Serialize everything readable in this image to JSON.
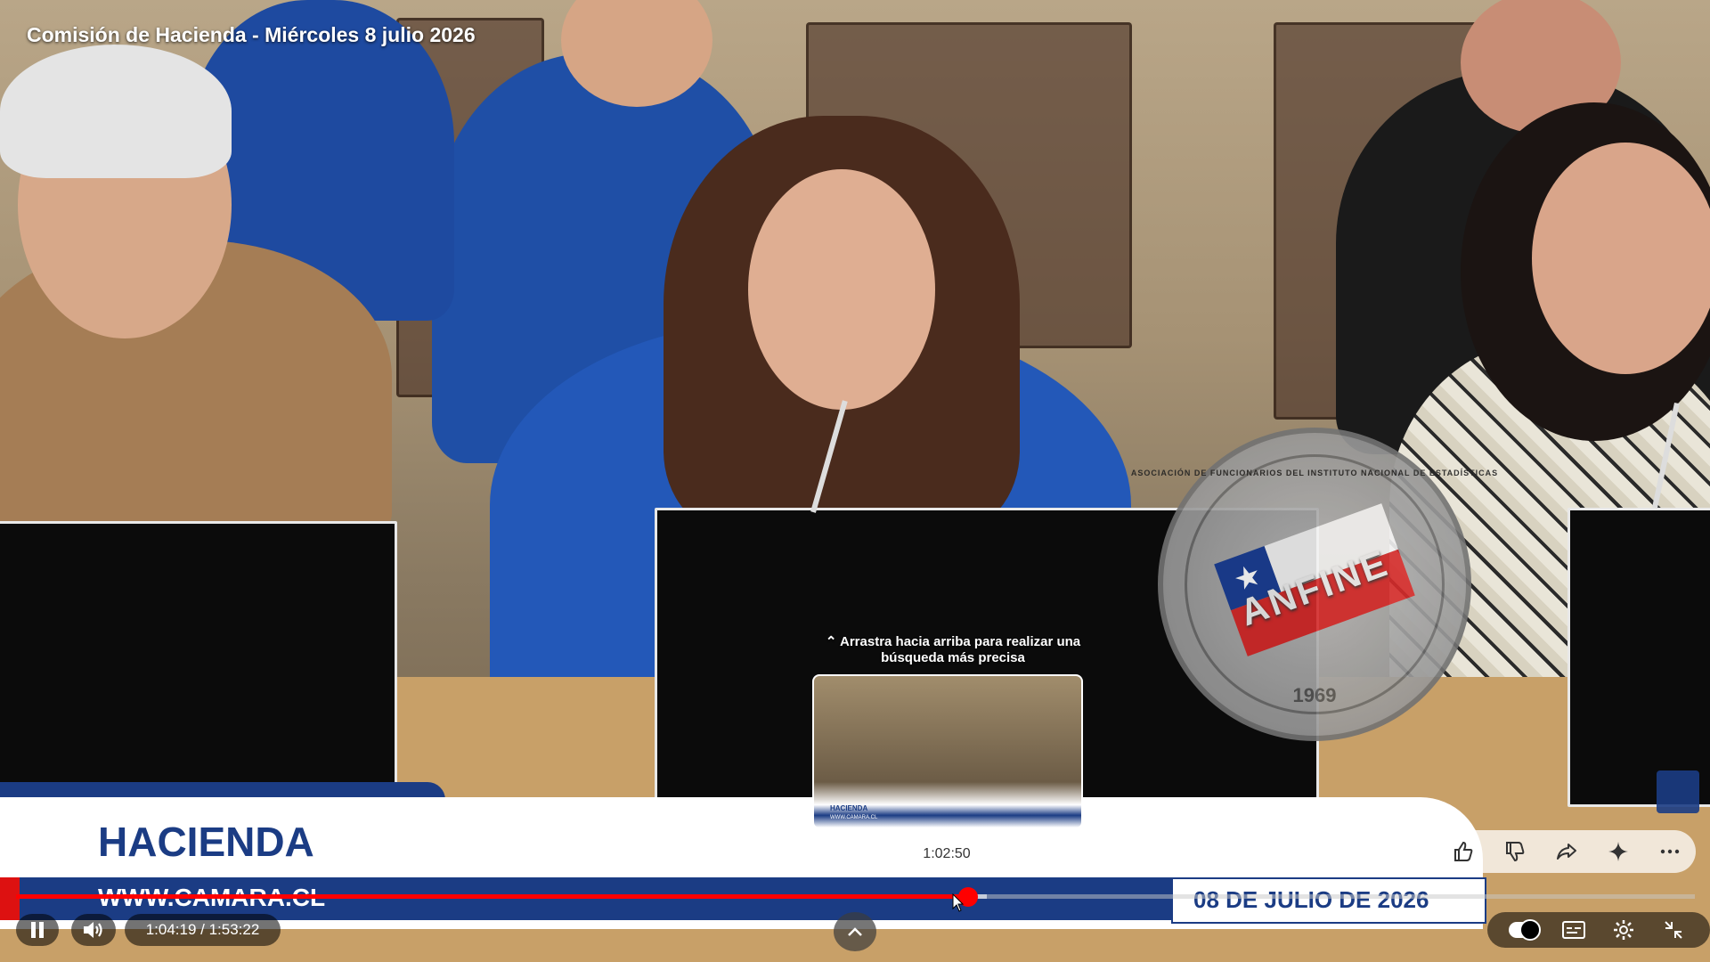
{
  "video": {
    "title_overlay": "Comisión de Hacienda - Miércoles 8 julio 2026"
  },
  "watermark": {
    "org_text": "ASOCIACIÓN DE FUNCIONARIOS DEL INSTITUTO NACIONAL DE ESTADÍSTICAS",
    "name": "ANFINE",
    "year": "1969"
  },
  "lower_third": {
    "title": "HACIENDA",
    "url": "WWW.CAMARA.CL",
    "date": "08 DE JULIO DE 2026"
  },
  "seek_preview": {
    "hint": "⌃ Arrastra hacia arriba para realizar una búsqueda más precisa",
    "thumb_title": "HACIENDA",
    "thumb_url": "WWW.CAMARA.CL",
    "time": "1:02:50"
  },
  "player": {
    "current_time": "1:04:19",
    "duration": "1:53:22",
    "time_display": "1:04:19 / 1:53:22",
    "played_fraction": 0.567,
    "buffered_fraction": 0.578,
    "accent_color": "#ff0000"
  },
  "icons": {
    "play_pause": "pause-icon",
    "volume": "volume-icon",
    "expand": "chevron-up-icon",
    "like": "thumbs-up-icon",
    "dislike": "thumbs-down-icon",
    "share": "share-icon",
    "ask": "sparkle-icon",
    "more": "more-icon",
    "autoplay": "autoplay-toggle-icon",
    "captions": "captions-icon",
    "settings": "settings-icon",
    "exit_fullscreen": "exit-fullscreen-icon"
  }
}
